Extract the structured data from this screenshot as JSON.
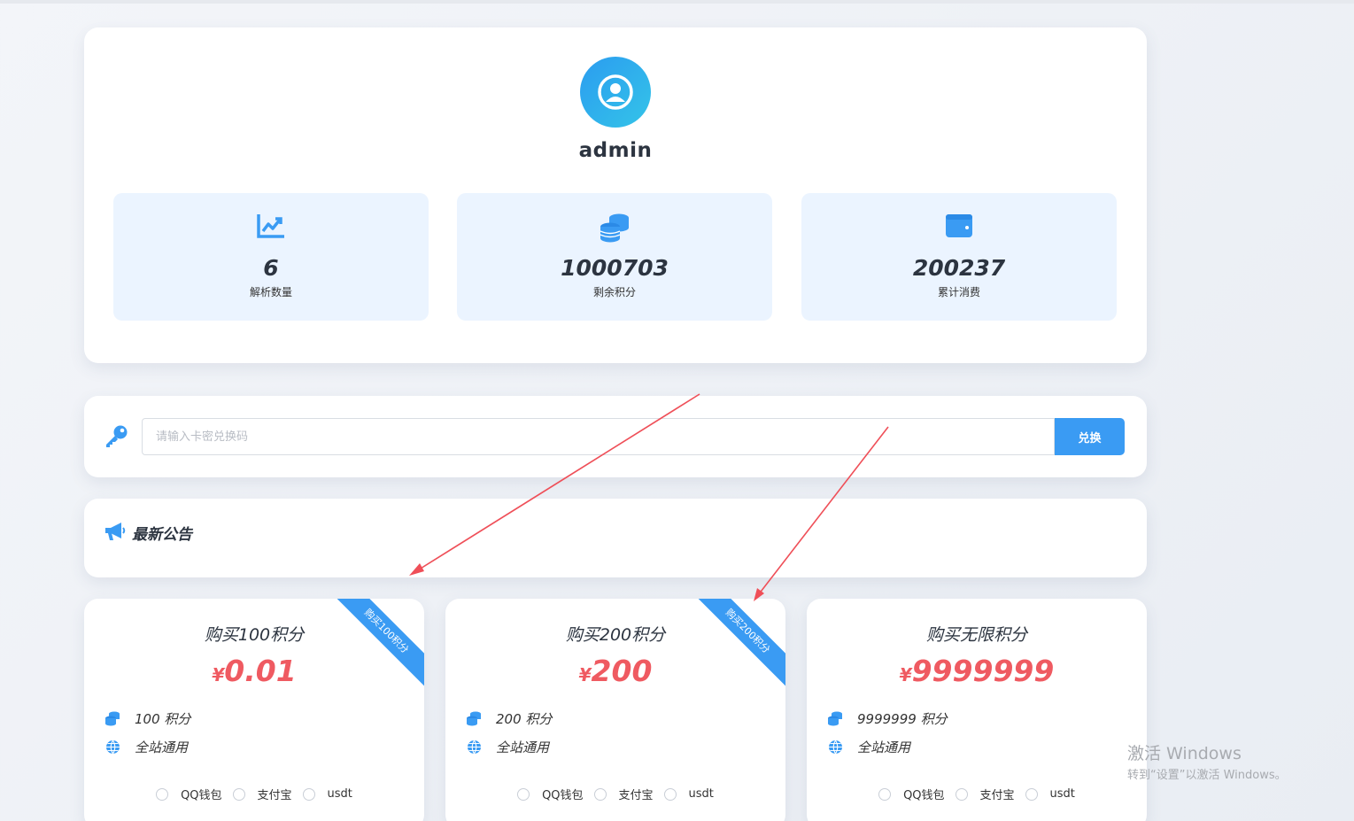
{
  "profile": {
    "username": "admin",
    "stats": [
      {
        "value": "6",
        "label": "解析数量",
        "icon": "chart-line-icon"
      },
      {
        "value": "1000703",
        "label": "剩余积分",
        "icon": "coins-icon"
      },
      {
        "value": "200237",
        "label": "累计消费",
        "icon": "wallet-icon"
      }
    ]
  },
  "redeem": {
    "placeholder": "请输入卡密兑换码",
    "button_label": "兑换"
  },
  "notice": {
    "title": "最新公告"
  },
  "packages": [
    {
      "title": "购买100积分",
      "currency": "¥",
      "price": "0.01",
      "points": "100 积分",
      "scope": "全站通用",
      "ribbon": "购买100积分"
    },
    {
      "title": "购买200积分",
      "currency": "¥",
      "price": "200",
      "points": "200 积分",
      "scope": "全站通用",
      "ribbon": "购买200积分"
    },
    {
      "title": "购买无限积分",
      "currency": "¥",
      "price": "9999999",
      "points": "9999999 积分",
      "scope": "全站通用",
      "ribbon": ""
    }
  ],
  "payment_methods": [
    "QQ钱包",
    "支付宝",
    "usdt"
  ],
  "watermark": {
    "line1": "激活 Windows",
    "line2": "转到“设置”以激活 Windows。"
  },
  "colors": {
    "accent": "#3a9bf3",
    "price": "#ef5a61",
    "stat_bg": "#ebf4ff",
    "arrow": "#ef4f58"
  }
}
